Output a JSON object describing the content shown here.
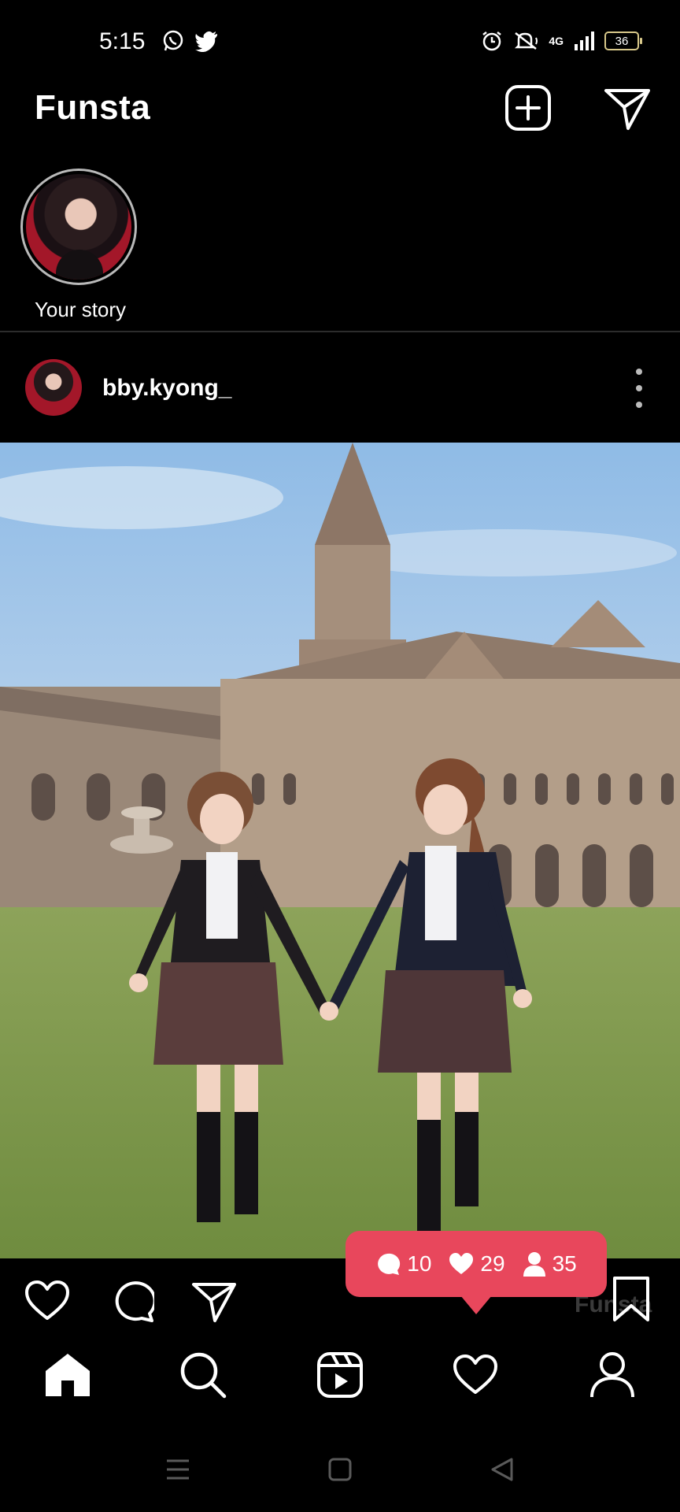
{
  "status_bar": {
    "time": "5:15",
    "network": "4G",
    "battery": "36",
    "left_icons": [
      "whatsapp-icon",
      "twitter-icon"
    ],
    "right_icons": [
      "alarm-icon",
      "mute-icon",
      "signal-icon",
      "battery-icon"
    ]
  },
  "header": {
    "title": "Funsta",
    "icons": [
      "add-post-icon",
      "direct-message-icon"
    ]
  },
  "stories": [
    {
      "label": "Your story"
    }
  ],
  "post": {
    "username": "bby.kyong_",
    "watermark": "Funsta",
    "action_icons": [
      "like-icon",
      "comment-icon",
      "share-icon",
      "bookmark-icon"
    ]
  },
  "notification": {
    "comments": "10",
    "likes": "29",
    "followers": "35",
    "color": "#e8475c"
  },
  "bottom_nav": {
    "items": [
      "home-icon",
      "search-icon",
      "reels-icon",
      "activity-icon",
      "profile-icon"
    ]
  },
  "system_nav": [
    "menu-icon",
    "home-button-icon",
    "back-icon"
  ]
}
